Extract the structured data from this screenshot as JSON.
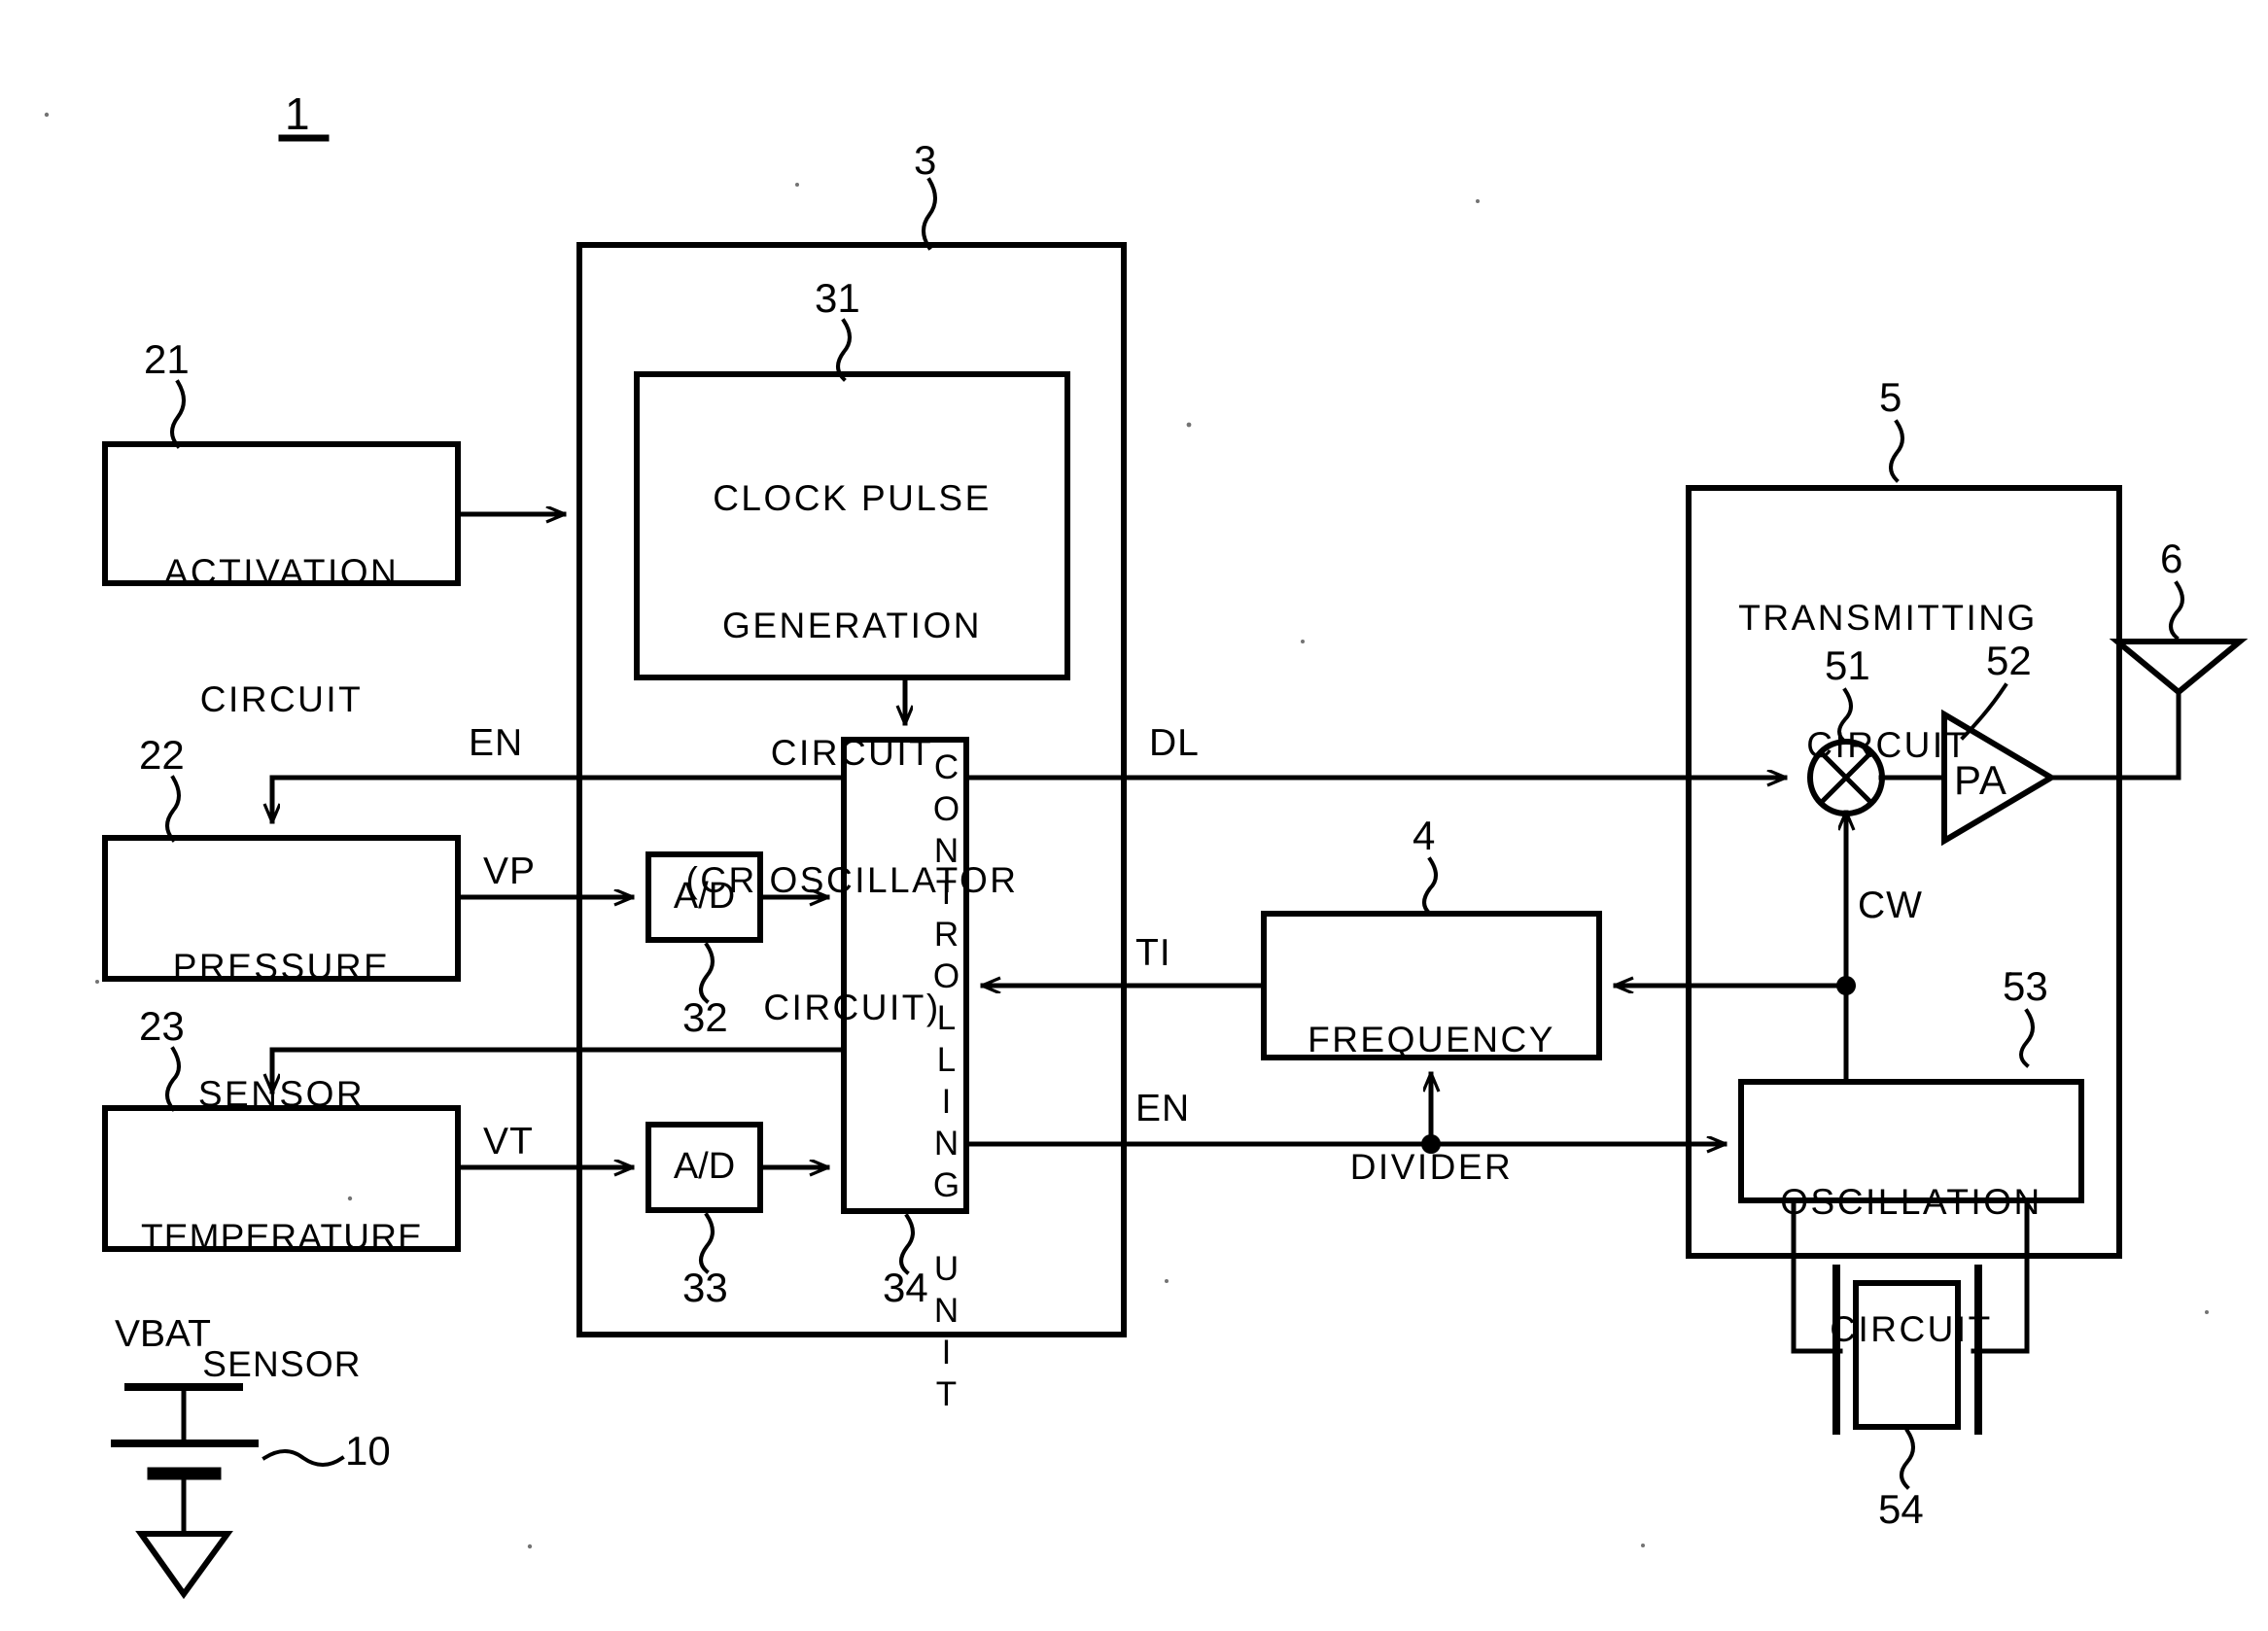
{
  "figure": {
    "type": "patent-block-diagram",
    "overall_ref": "1"
  },
  "blocks": {
    "activation_circuit": {
      "ref": "21",
      "line1": "ACTIVATION",
      "line2": "CIRCUIT"
    },
    "pressure_sensor": {
      "ref": "22",
      "line1": "PRESSURE",
      "line2": "SENSOR"
    },
    "temperature_sensor": {
      "ref": "23",
      "line1": "TEMPERATURE",
      "line2": "SENSOR"
    },
    "signal_processing": {
      "ref": "3"
    },
    "clock_pulse_generation": {
      "ref": "31",
      "line1": "CLOCK PULSE",
      "line2": "GENERATION",
      "line3": "CIRCUIT",
      "line4": "(CR OSCILLATOR",
      "line5": "CIRCUIT)"
    },
    "ad_converter_1": {
      "ref": "32",
      "label": "A/D"
    },
    "ad_converter_2": {
      "ref": "33",
      "label": "A/D"
    },
    "controlling_unit": {
      "ref": "34",
      "label": "CONTROLLING UNIT"
    },
    "frequency_divider": {
      "ref": "4",
      "line1": "FREQUENCY",
      "line2": "DIVIDER"
    },
    "transmitting_circuit": {
      "ref": "5",
      "line1": "TRANSMITTING",
      "line2": "CIRCUIT"
    },
    "mixer": {
      "ref": "51"
    },
    "power_amplifier": {
      "ref": "52",
      "label": "PA"
    },
    "oscillation_circuit": {
      "ref": "53",
      "line1": "OSCILLATION",
      "line2": "CIRCUIT"
    },
    "crystal_resonator": {
      "ref": "54"
    },
    "antenna": {
      "ref": "6"
    },
    "battery": {
      "ref": "10",
      "label": "VBAT"
    }
  },
  "signals": {
    "en_top": "EN",
    "en_bottom": "EN",
    "dl": "DL",
    "ti": "TI",
    "cw": "CW",
    "vp": "VP",
    "vt": "VT"
  },
  "colors": {
    "line": "#000000",
    "background": "#ffffff"
  }
}
